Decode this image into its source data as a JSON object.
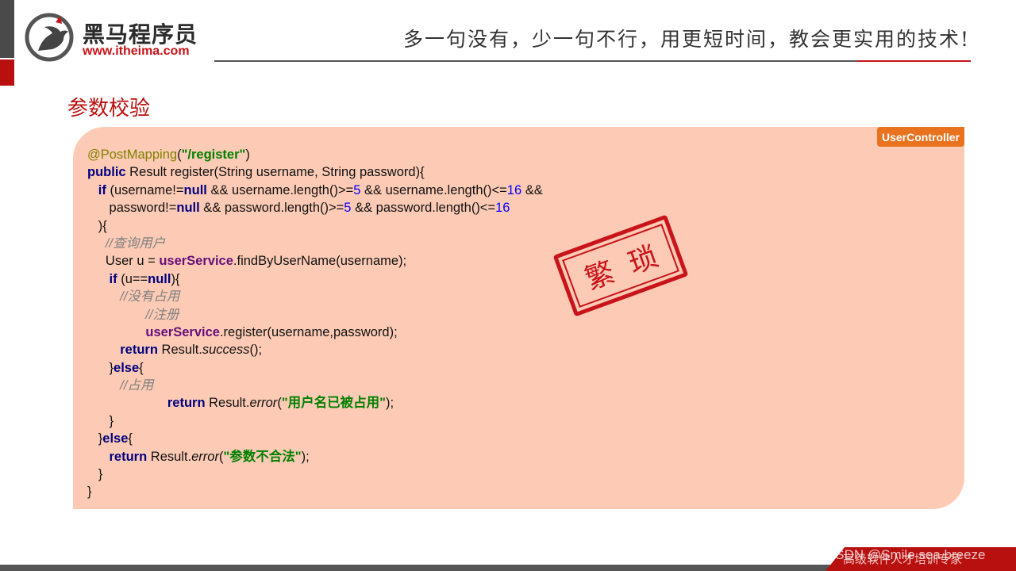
{
  "header": {
    "logo_cn": "黑马程序员",
    "logo_url": "www.itheima.com",
    "slogan": "多一句没有，少一句不行，用更短时间，教会更实用的技术!"
  },
  "section_title": "参数校验",
  "tag_label": "UserController",
  "stamp_text": "繁琐",
  "code": {
    "l1_ann": "@PostMapping",
    "l1_str": "\"/register\"",
    "l2_kw": "public",
    "l2_rest": " Result register(String username, String password){",
    "l3_if": "if",
    "l3_a": " (username!=",
    "l3_null": "null",
    "l3_b": " && username.length()>=",
    "l3_n1": "5",
    "l3_c": " && username.length()<=",
    "l3_n2": "16",
    "l3_d": " &&",
    "l4_a": "password!=",
    "l4_null": "null",
    "l4_b": " && password.length()>=",
    "l4_n1": "5",
    "l4_c": " && password.length()<=",
    "l4_n2": "16",
    "l5": "){",
    "l6_cmt": "//查询用户",
    "l7_a": "User u = ",
    "l7_fld": "userService",
    "l7_b": ".findByUserName(username);",
    "l8_if": "if",
    "l8_a": " (u==",
    "l8_null": "null",
    "l8_b": "){",
    "l9_cmt": "//没有占用",
    "l10_cmt": "//注册",
    "l11_fld": "userService",
    "l11_b": ".register(username,password);",
    "l12_ret": "return",
    "l12_a": " Result.",
    "l12_it": "success",
    "l12_b": "();",
    "l13_a": "}",
    "l13_else": "else",
    "l13_b": "{",
    "l14_cmt": "//占用",
    "l15_ret": "return",
    "l15_a": " Result.",
    "l15_it": "error",
    "l15_b": "(",
    "l15_str": "\"用户名已被占用\"",
    "l15_c": ");",
    "l16": "}",
    "l17_a": "}",
    "l17_else": "else",
    "l17_b": "{",
    "l18_ret": "return",
    "l18_a": " Result.",
    "l18_it": "error",
    "l18_b": "(",
    "l18_str": "\"参数不合法\"",
    "l18_c": ");",
    "l19": "}",
    "l20": "}"
  },
  "footer": {
    "text": "高级软件人才培训专家",
    "watermark": "CSDN @Smile sea breeze"
  },
  "colors": {
    "brand_red": "#b8100f",
    "panel_bg": "#fdcbb5",
    "tag_bg": "#e8721e"
  }
}
